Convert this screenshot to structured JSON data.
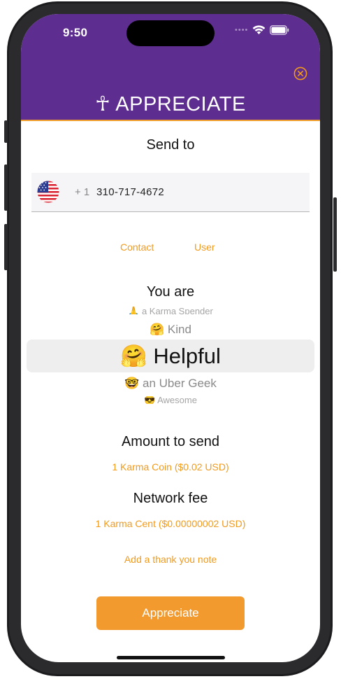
{
  "status_bar": {
    "time": "9:50"
  },
  "header": {
    "title": "☥ APPRECIATE"
  },
  "send_to": {
    "label": "Send to",
    "country_code": "+ 1",
    "phone_number": "310-717-4672",
    "contact_link": "Contact",
    "user_link": "User"
  },
  "you_are": {
    "label": "You are",
    "options": [
      "🙏 a Karma Spender",
      "🤗 Kind",
      "🤗 Helpful",
      "🤓 an Uber Geek",
      "😎 Awesome"
    ],
    "selected_index": 2
  },
  "amount": {
    "label": "Amount to send",
    "value": "1 Karma Coin ($0.02 USD)"
  },
  "network_fee": {
    "label": "Network fee",
    "value": "1 Karma Cent ($0.00000002 USD)"
  },
  "note": {
    "link": "Add a thank you note"
  },
  "submit": {
    "label": "Appreciate"
  },
  "colors": {
    "header_bg": "#5d2d90",
    "accent": "#f29a1c",
    "button_bg": "#f29a2e"
  }
}
